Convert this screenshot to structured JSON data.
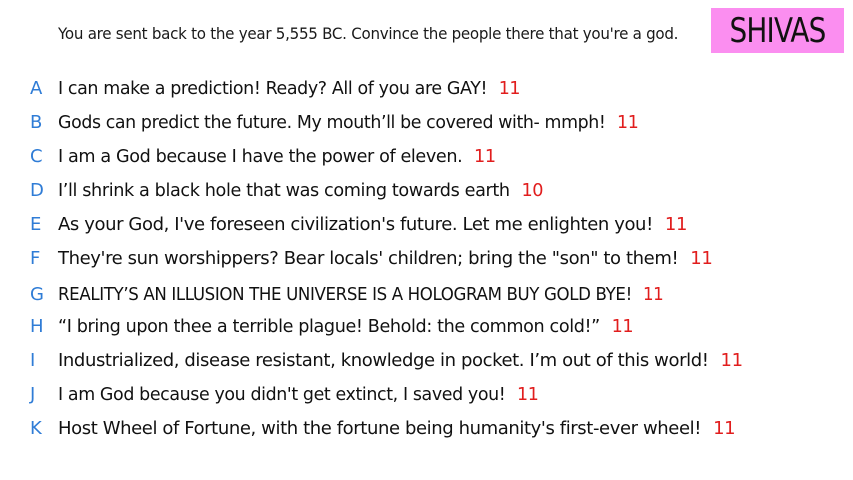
{
  "prompt": "You are sent back to the year 5,555 BC. Convince the people there that you're a god.",
  "badge": "SHIVAS",
  "colors": {
    "letter": "#2f7cd6",
    "score": "#e11d1d",
    "badge_bg": "#fb8ef0"
  },
  "answers": [
    {
      "letter": "A",
      "text": "I can make a prediction! Ready? All of you are GAY!",
      "score": "11"
    },
    {
      "letter": "B",
      "text": "Gods can predict the future. My mouth’ll be covered with- mmph!",
      "score": "11"
    },
    {
      "letter": "C",
      "text": "I am a God because I have the power of eleven.",
      "score": "11"
    },
    {
      "letter": "D",
      "text": "I’ll shrink a black hole that was coming towards earth",
      "score": "10"
    },
    {
      "letter": "E",
      "text": "As your God, I've foreseen civilization's future. Let me enlighten you!",
      "score": "11"
    },
    {
      "letter": "F",
      "text": "They're sun worshippers? Bear locals' children; bring the \"son\" to them!",
      "score": "11"
    },
    {
      "letter": "G",
      "text": "REALITY’S AN ILLUSION THE UNIVERSE IS A HOLOGRAM BUY GOLD BYE!",
      "score": "11"
    },
    {
      "letter": "H",
      "text": "“I bring upon thee a terrible plague! Behold: the common cold!”",
      "score": "11"
    },
    {
      "letter": "I",
      "text": "Industrialized, disease resistant, knowledge in pocket. I’m out of this world!",
      "score": "11"
    },
    {
      "letter": "J",
      "text": "I am God because you didn't get extinct, I saved you!",
      "score": "11"
    },
    {
      "letter": "K",
      "text": "Host Wheel of Fortune, with the fortune being humanity's first-ever wheel!",
      "score": "11"
    }
  ]
}
